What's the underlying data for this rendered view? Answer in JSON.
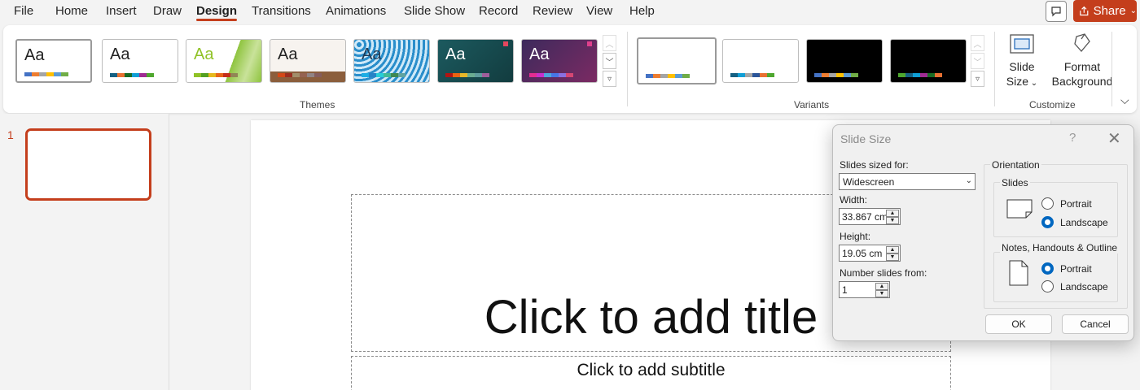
{
  "menu": {
    "items": [
      "File",
      "Home",
      "Insert",
      "Draw",
      "Design",
      "Transitions",
      "Animations",
      "Slide Show",
      "Record",
      "Review",
      "View",
      "Help"
    ],
    "active": "Design",
    "share_label": "Share"
  },
  "ribbon": {
    "themes_label": "Themes",
    "variants_label": "Variants",
    "customize_label": "Customize",
    "theme_sample_text": "Aa",
    "slide_size_label": [
      "Slide",
      "Size"
    ],
    "format_background_label": [
      "Format",
      "Background"
    ]
  },
  "slide_panel": {
    "slide_number": "1"
  },
  "slide": {
    "title_placeholder": "Click to add title",
    "subtitle_placeholder": "Click to add subtitle"
  },
  "dialog": {
    "title": "Slide Size",
    "help": "?",
    "close": "✕",
    "slides_sized_for_label": "Slides sized for:",
    "slides_sized_for_value": "Widescreen",
    "width_label": "Width:",
    "width_value": "33.867 cm",
    "height_label": "Height:",
    "height_value": "19.05 cm",
    "number_from_label": "Number slides from:",
    "number_from_value": "1",
    "orientation_label": "Orientation",
    "slides_group_label": "Slides",
    "notes_group_label": "Notes, Handouts & Outline",
    "portrait_label": "Portrait",
    "landscape_label": "Landscape",
    "slides_orientation": "Landscape",
    "notes_orientation": "Portrait",
    "ok_label": "OK",
    "cancel_label": "Cancel"
  },
  "colors": {
    "accent": "#c43e1c",
    "radio_selected": "#0067c0"
  }
}
